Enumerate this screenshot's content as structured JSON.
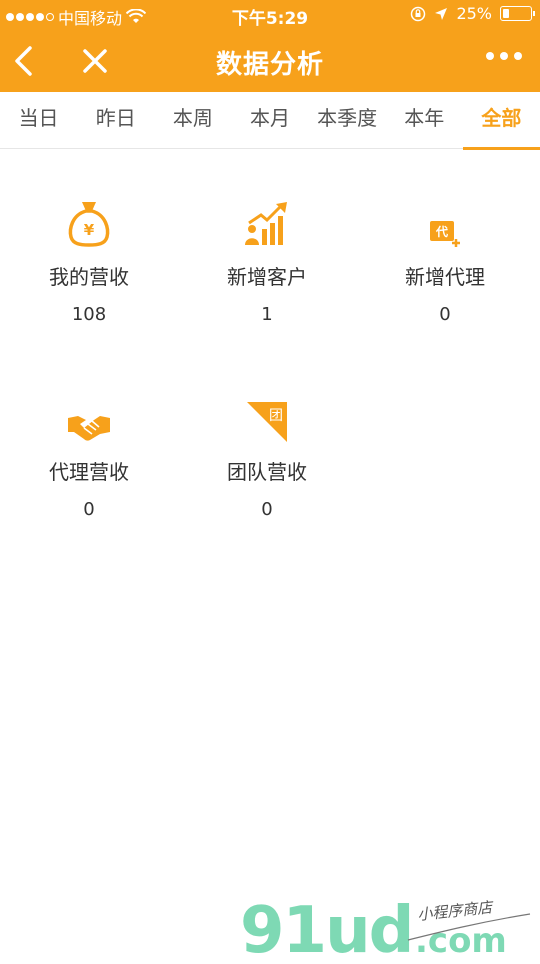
{
  "status_bar": {
    "carrier": "中国移动",
    "time": "下午5:29",
    "battery": "25%"
  },
  "nav": {
    "title": "数据分析"
  },
  "tabs": [
    {
      "label": "当日"
    },
    {
      "label": "昨日"
    },
    {
      "label": "本周"
    },
    {
      "label": "本月"
    },
    {
      "label": "本季度"
    },
    {
      "label": "本年"
    },
    {
      "label": "全部"
    }
  ],
  "active_tab": "全部",
  "stats": [
    {
      "label": "我的营收",
      "value": "108",
      "icon": "money-bag-icon"
    },
    {
      "label": "新增客户",
      "value": "1",
      "icon": "growth-chart-icon"
    },
    {
      "label": "新增代理",
      "value": "0",
      "icon": "add-agent-icon"
    },
    {
      "label": "代理营收",
      "value": "0",
      "icon": "handshake-icon"
    },
    {
      "label": "团队营收",
      "value": "0",
      "icon": "team-flag-icon"
    }
  ],
  "watermark": {
    "logo": "91ud",
    "suffix": ".com",
    "tagline": "小程序商店"
  },
  "colors": {
    "accent": "#F7A11B",
    "watermark_green": "#7ED9B4"
  }
}
